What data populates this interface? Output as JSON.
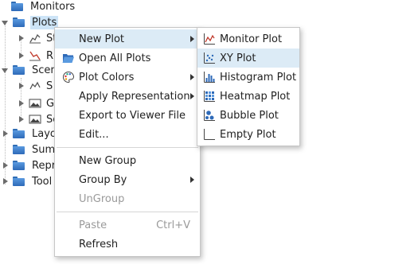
{
  "tree": {
    "monitors": "Monitors",
    "plots": "Plots",
    "plot_child_1": "St",
    "plot_child_2": "R",
    "scenes": "Scen",
    "scene_child_1": "S",
    "scene_child_2": "G",
    "scene_child_3": "Sc",
    "layouts": "Layo",
    "summaries": "Sum",
    "reports": "Repr",
    "tools": "Tool"
  },
  "context_menu": {
    "new_plot": "New Plot",
    "open_all_plots": "Open All Plots",
    "plot_colors": "Plot Colors",
    "apply_representation": "Apply Representation",
    "export_to_viewer_file": "Export to Viewer File",
    "edit": "Edit...",
    "new_group": "New Group",
    "group_by": "Group By",
    "ungroup": "UnGroup",
    "paste": "Paste",
    "paste_shortcut": "Ctrl+V",
    "refresh": "Refresh"
  },
  "new_plot_submenu": {
    "monitor_plot": "Monitor Plot",
    "xy_plot": "XY Plot",
    "histogram_plot": "Histogram Plot",
    "heatmap_plot": "Heatmap Plot",
    "bubble_plot": "Bubble Plot",
    "empty_plot": "Empty Plot"
  },
  "colors": {
    "selection": "#cde4f7",
    "menu_highlight": "#dcebf6",
    "folder": "#3b7bc8",
    "disabled_text": "#9a9a9a"
  }
}
